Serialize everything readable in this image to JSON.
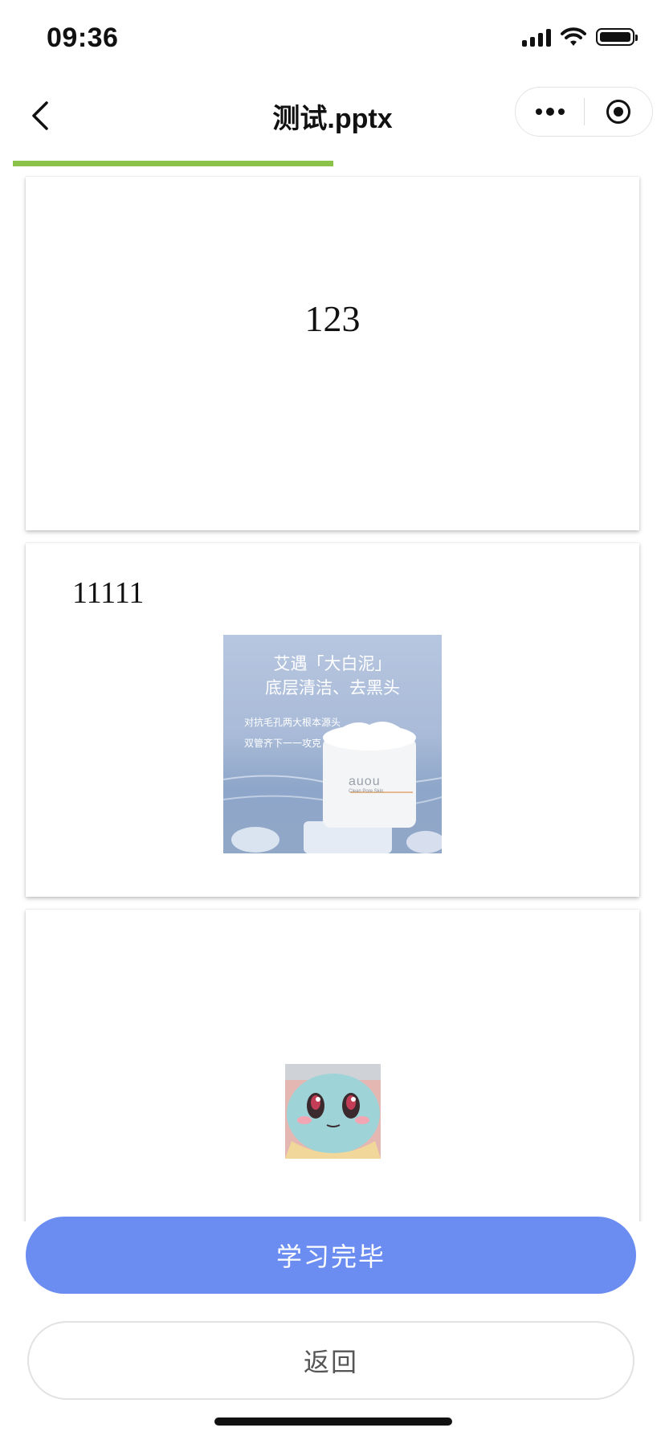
{
  "status_bar": {
    "time": "09:36"
  },
  "nav": {
    "title": "测试.pptx",
    "back_icon": "chevron-left-icon",
    "more_icon": "more-dots-icon",
    "close_icon": "target-circle-icon"
  },
  "progress": {
    "value_percent": 50,
    "color": "#8bc34a"
  },
  "slides": [
    {
      "text": "123"
    },
    {
      "text": "11111",
      "image": {
        "headline_1": "艾遇「大白泥」",
        "headline_2": "底层清洁、去黑头",
        "bullets": [
          "对抗毛孔两大根本源头",
          "双管齐下一一攻克"
        ],
        "brand": "auou",
        "product_name": "Clean Pore Skin"
      }
    },
    {
      "text": ""
    }
  ],
  "actions": {
    "primary_label": "学习完毕",
    "secondary_label": "返回"
  },
  "colors": {
    "primary": "#6b8df2",
    "progress": "#8bc34a"
  }
}
